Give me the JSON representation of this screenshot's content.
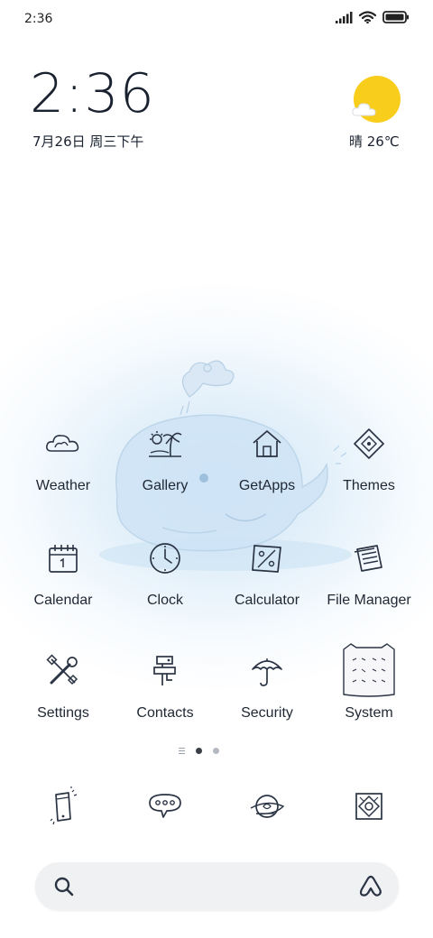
{
  "status_bar": {
    "time": "2:36",
    "icons": [
      "signal-icon",
      "wifi-icon",
      "battery-icon"
    ]
  },
  "clock_widget": {
    "time": "2:36",
    "date": "7月26日 周三下午"
  },
  "weather_widget": {
    "text": "晴 26℃",
    "icon": "sun-cloud-icon"
  },
  "apps": [
    {
      "label": "Weather",
      "icon": "weather-cloud-icon"
    },
    {
      "label": "Gallery",
      "icon": "palm-tree-icon"
    },
    {
      "label": "GetApps",
      "icon": "house-icon"
    },
    {
      "label": "Themes",
      "icon": "diamond-icon"
    },
    {
      "label": "Calendar",
      "icon": "calendar-icon"
    },
    {
      "label": "Clock",
      "icon": "clock-icon"
    },
    {
      "label": "Calculator",
      "icon": "calculator-icon"
    },
    {
      "label": "File Manager",
      "icon": "folder-icon"
    },
    {
      "label": "Settings",
      "icon": "tools-icon"
    },
    {
      "label": "Contacts",
      "icon": "contacts-icon"
    },
    {
      "label": "Security",
      "icon": "umbrella-icon"
    },
    {
      "label": "System",
      "icon": "system-folder-icon"
    }
  ],
  "page_indicator": {
    "pages": 2,
    "current": 1
  },
  "dock": [
    "phone-icon",
    "messages-icon",
    "browser-icon",
    "camera-icon"
  ],
  "search_bar": {
    "left_icon": "search-icon",
    "right_icon": "assistant-icon"
  },
  "colors": {
    "sun": "#f9cd1c",
    "line_art": "#2b3444",
    "whale": "#bcd9f0"
  }
}
